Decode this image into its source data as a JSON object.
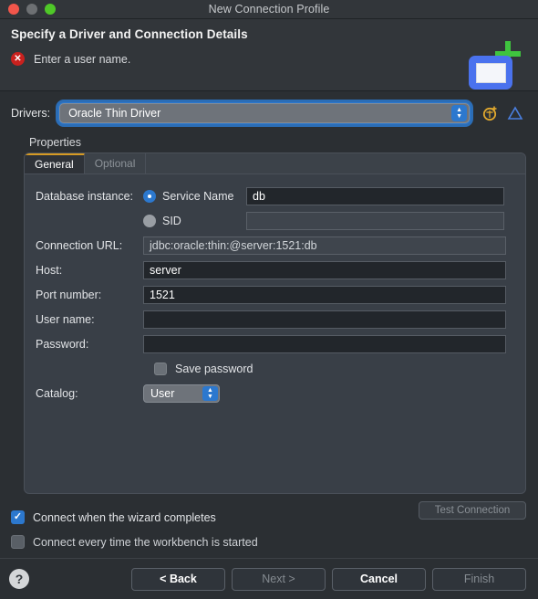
{
  "window": {
    "title": "New Connection Profile"
  },
  "titlebar": {
    "close": "close-button",
    "minimize": "minimize-button",
    "zoom": "zoom-button"
  },
  "header": {
    "heading": "Specify a Driver and Connection Details",
    "error_message": "Enter a user name.",
    "error_icon": "error-x-icon",
    "graphic": {
      "plus_color": "#3fc43f",
      "card_color": "#4a72ee"
    }
  },
  "drivers": {
    "label": "Drivers:",
    "selected": "Oracle Thin Driver",
    "focus_color": "#2c78ce",
    "new_driver_icon": "new-driver-icon",
    "edit_driver_icon": "triangle-icon"
  },
  "properties": {
    "group_label": "Properties",
    "tabs": [
      {
        "label": "General",
        "active": true
      },
      {
        "label": "Optional",
        "active": false
      }
    ],
    "fields": {
      "database_instance_label": "Database instance:",
      "service_name_label": "Service Name",
      "service_name_value": "db",
      "service_name_selected": true,
      "sid_label": "SID",
      "sid_value": "",
      "connection_url_label": "Connection URL:",
      "connection_url_value": "jdbc:oracle:thin:@server:1521:db",
      "host_label": "Host:",
      "host_value": "server",
      "port_label": "Port number:",
      "port_value": "1521",
      "username_label": "User name:",
      "username_value": "",
      "password_label": "Password:",
      "password_value": "",
      "save_password_label": "Save password",
      "save_password_checked": false,
      "catalog_label": "Catalog:",
      "catalog_value": "User"
    }
  },
  "options": {
    "connect_wizard_label": "Connect when the wizard completes",
    "connect_wizard_checked": true,
    "connect_startup_label": "Connect every time the workbench is started",
    "connect_startup_checked": false,
    "test_connection_label": "Test Connection"
  },
  "buttonbar": {
    "help_label": "?",
    "back_label": "< Back",
    "next_label": "Next >",
    "cancel_label": "Cancel",
    "finish_label": "Finish"
  }
}
